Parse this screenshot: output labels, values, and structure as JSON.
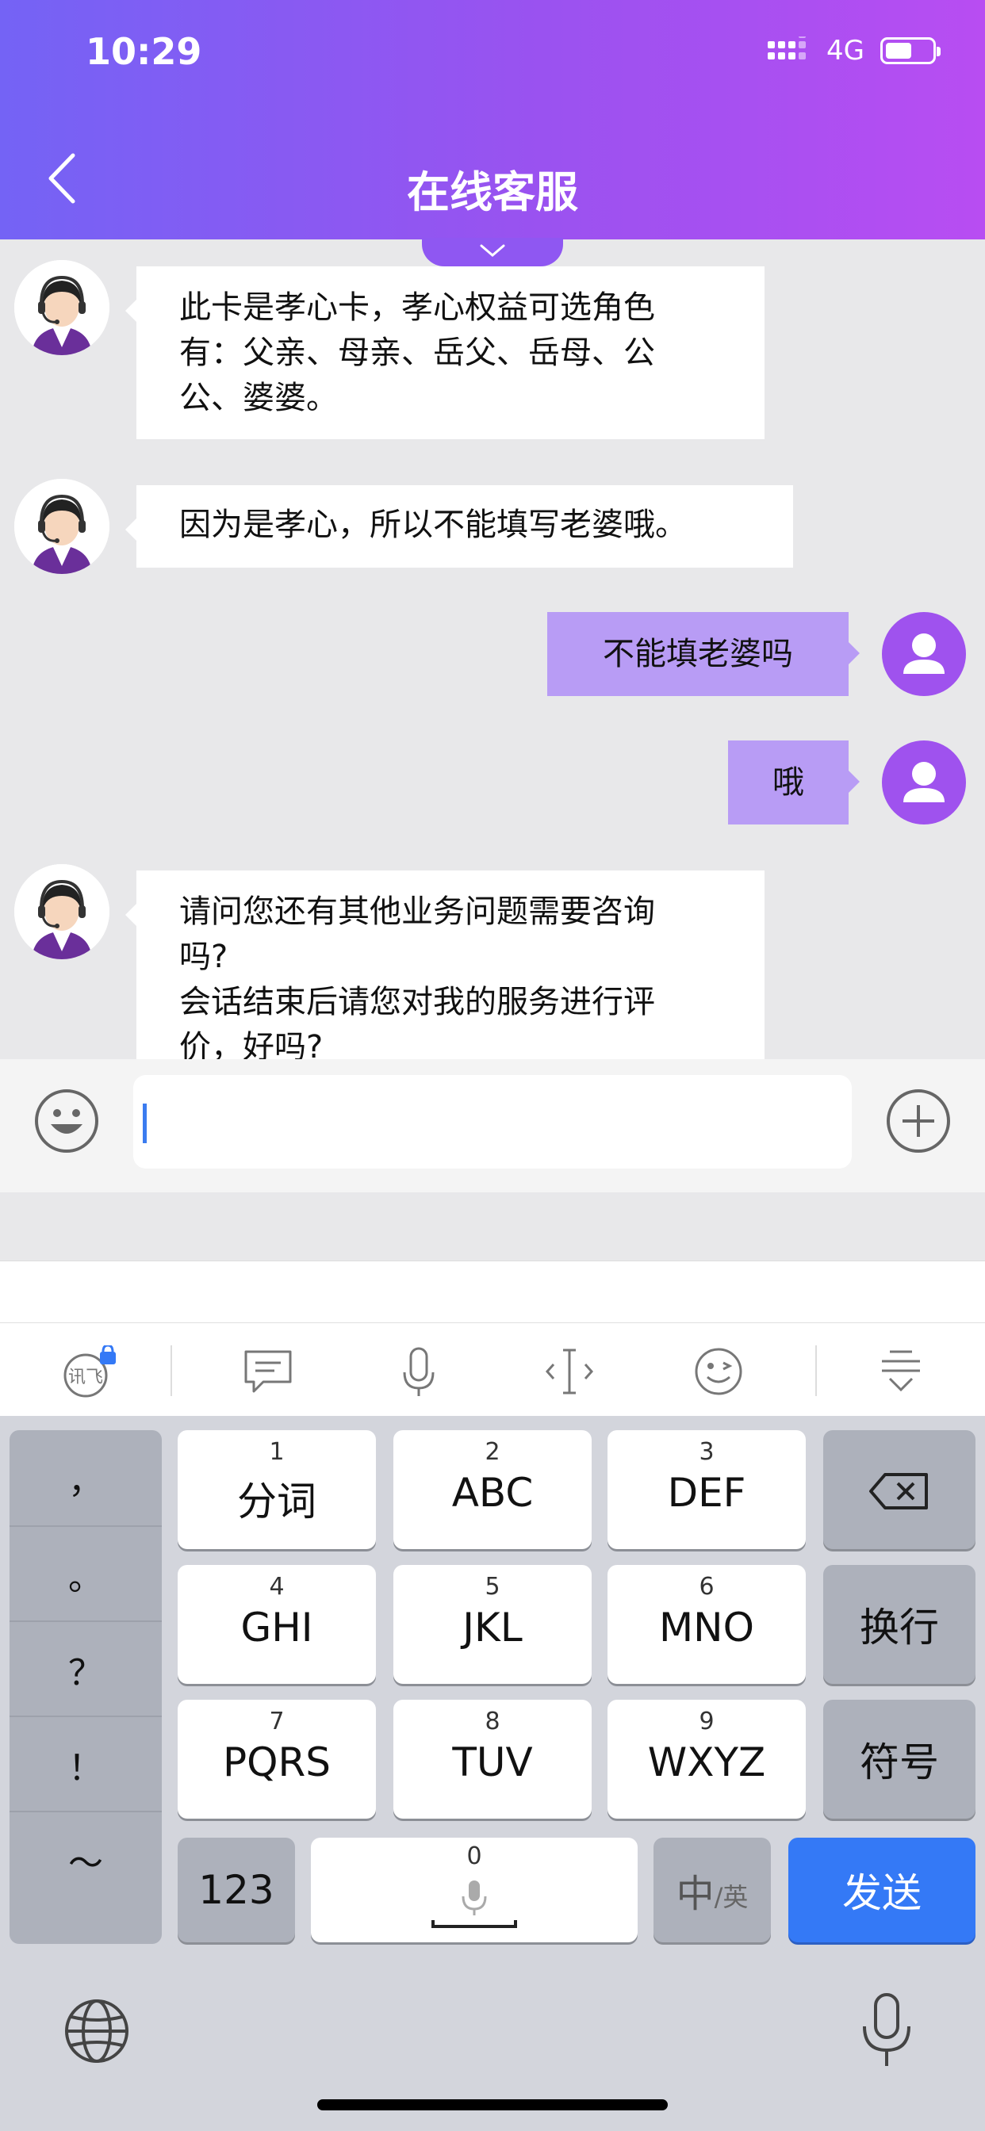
{
  "status_bar": {
    "time": "10:29",
    "network": "4G"
  },
  "header": {
    "title": "在线客服"
  },
  "messages": [
    {
      "from": "agent",
      "lines": [
        "此卡是孝心卡，孝心权益可选角色",
        "有：父亲、母亲、岳父、岳母、公",
        "公、婆婆。"
      ]
    },
    {
      "from": "agent",
      "lines": [
        "因为是孝心，所以不能填写老婆哦。"
      ]
    },
    {
      "from": "user",
      "text": "不能填老婆吗"
    },
    {
      "from": "user",
      "text": "哦"
    },
    {
      "from": "agent",
      "lines": [
        "请问您还有其他业务问题需要咨询",
        "吗?",
        "会话结束后请您对我的服务进行评",
        "价，好吗?"
      ]
    }
  ],
  "input": {
    "value": ""
  },
  "keyboard": {
    "punctuation": [
      "，",
      "。",
      "？",
      "！",
      "～"
    ],
    "keys": [
      {
        "num": "1",
        "label": "分词"
      },
      {
        "num": "2",
        "label": "ABC"
      },
      {
        "num": "3",
        "label": "DEF"
      },
      {
        "num": "4",
        "label": "GHI"
      },
      {
        "num": "5",
        "label": "JKL"
      },
      {
        "num": "6",
        "label": "MNO"
      },
      {
        "num": "7",
        "label": "PQRS"
      },
      {
        "num": "8",
        "label": "TUV"
      },
      {
        "num": "9",
        "label": "WXYZ"
      }
    ],
    "newline": "换行",
    "symbols": "符号",
    "numbers": "123",
    "space_num": "0",
    "lang_main": "中",
    "lang_sub": "/英",
    "send": "发送",
    "toolbar_brand": "讯飞"
  },
  "colors": {
    "header_start": "#7463f5",
    "header_end": "#b84df2",
    "user_bubble": "#b89cf5",
    "send_button": "#3479f6"
  }
}
